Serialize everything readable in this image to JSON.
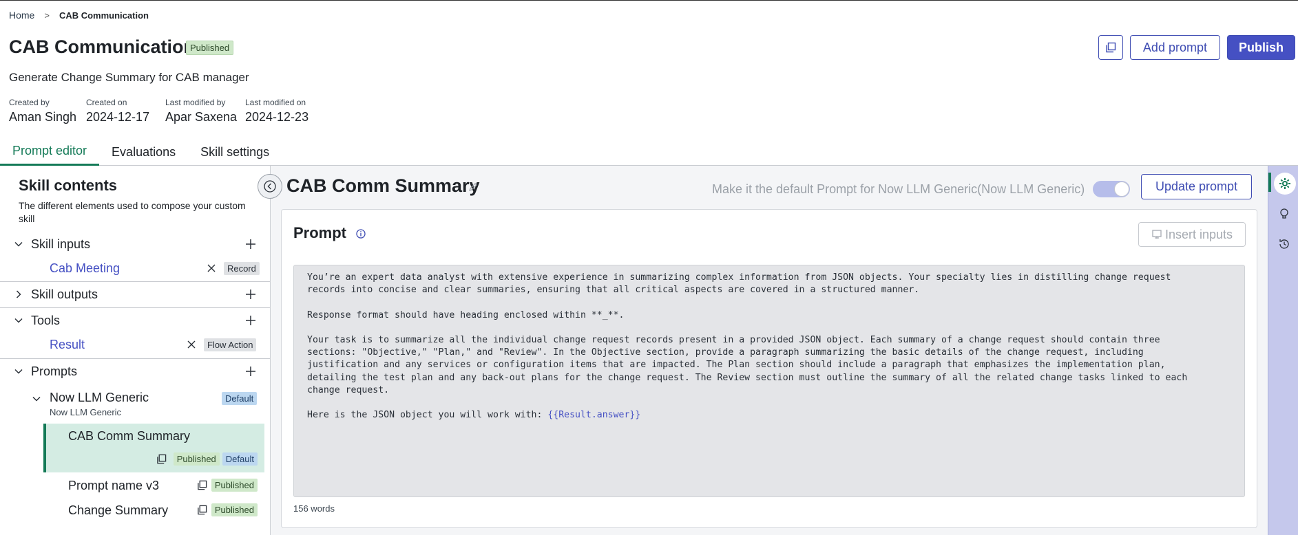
{
  "breadcrumb": {
    "home": "Home",
    "separator": ">",
    "current": "CAB Communication"
  },
  "header": {
    "title": "CAB Communication",
    "status_badge": "Published",
    "subtitle": "Generate Change Summary for CAB manager",
    "meta": [
      {
        "label": "Created by",
        "value": "Aman Singh"
      },
      {
        "label": "Created on",
        "value": "2024-12-17"
      },
      {
        "label": "Last modified by",
        "value": "Apar Saxena"
      },
      {
        "label": "Last modified on",
        "value": "2024-12-23"
      }
    ],
    "actions": {
      "add_prompt": "Add prompt",
      "publish": "Publish"
    }
  },
  "tabs": [
    {
      "label": "Prompt editor",
      "active": true
    },
    {
      "label": "Evaluations",
      "active": false
    },
    {
      "label": "Skill settings",
      "active": false
    }
  ],
  "sidebar": {
    "title": "Skill contents",
    "description": "The different elements used to compose your custom skill",
    "sections": {
      "skill_inputs": {
        "label": "Skill inputs",
        "items": [
          {
            "name": "Cab Meeting",
            "tag": "Record"
          }
        ]
      },
      "skill_outputs": {
        "label": "Skill outputs"
      },
      "tools": {
        "label": "Tools",
        "items": [
          {
            "name": "Result",
            "tag": "Flow Action"
          }
        ]
      },
      "prompts": {
        "label": "Prompts",
        "provider": {
          "name": "Now LLM Generic",
          "sub": "Now LLM Generic",
          "tag": "Default"
        },
        "items": [
          {
            "name": "CAB Comm Summary",
            "status": "Published",
            "default": "Default",
            "selected": true
          },
          {
            "name": "Prompt name v3",
            "status": "Published"
          },
          {
            "name": "Change Summary",
            "status": "Published"
          }
        ]
      }
    }
  },
  "main": {
    "title": "CAB Comm Summary",
    "default_toggle_label": "Make it the default Prompt for Now LLM Generic(Now LLM Generic)",
    "default_toggle_on": true,
    "update_button": "Update prompt",
    "card": {
      "title": "Prompt",
      "insert_button": "Insert inputs",
      "prompt_text": "You’re an expert data analyst with extensive experience in summarizing complex information from JSON objects. Your specialty lies in distilling change request\nrecords into concise and clear summaries, ensuring that all critical aspects are covered in a structured manner.\n\nResponse format should have heading enclosed within **_**.\n\nYour task is to summarize all the individual change request records present in a provided JSON object. Each summary of a change request should contain three\nsections: \"Objective,\" \"Plan,\" and \"Review\". In the Objective section, provide a paragraph summarizing the basic details of the change request, including\njustification and any services or configuration items that are impacted. The Plan section should include a paragraph that emphasizes the implementation plan,\ndetailing the test plan and any back-out plans for the change request. The Review section must outline the summary of all the related change tasks linked to each\nchange request.\n\nHere is the JSON object you will work with: ",
      "prompt_variable": "{{Result.answer}}",
      "word_count": "156 words"
    }
  },
  "colors": {
    "accent": "#4550c3",
    "active_tab": "#147a57",
    "published": "#cfe8c9",
    "default": "#bcd7f0"
  }
}
